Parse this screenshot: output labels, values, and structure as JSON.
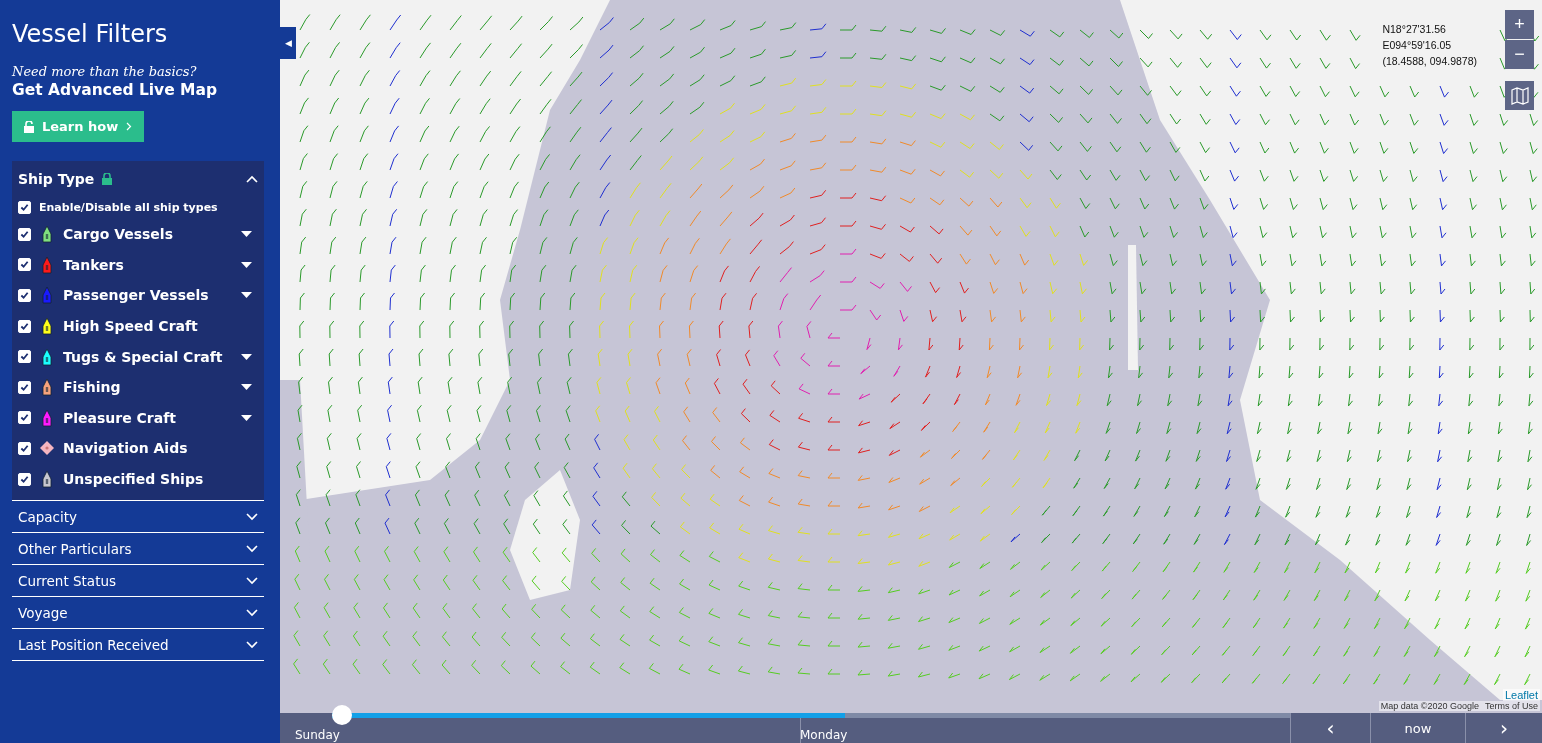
{
  "sidebar": {
    "title": "Vessel Filters",
    "promo_question": "Need more than the basics?",
    "promo_heading": "Get Advanced Live Map",
    "promo_button": "Learn how",
    "collapse_button": "◀"
  },
  "ship_type": {
    "title": "Ship Type",
    "expanded": true,
    "locked": true,
    "all_toggle": {
      "label": "Enable/Disable all ship types",
      "checked": true
    },
    "items": [
      {
        "label": "Cargo Vessels",
        "checked": true,
        "kind": "ship",
        "color": "#7fe07f",
        "expandable": true
      },
      {
        "label": "Tankers",
        "checked": true,
        "kind": "ship",
        "color": "#ff1a1a",
        "expandable": true
      },
      {
        "label": "Passenger Vessels",
        "checked": true,
        "kind": "ship",
        "color": "#1a1aff",
        "expandable": true
      },
      {
        "label": "High Speed Craft",
        "checked": true,
        "kind": "ship",
        "color": "#ffff1a",
        "expandable": false
      },
      {
        "label": "Tugs & Special Craft",
        "checked": true,
        "kind": "ship",
        "color": "#1affff",
        "expandable": true
      },
      {
        "label": "Fishing",
        "checked": true,
        "kind": "ship",
        "color": "#f7a27c",
        "expandable": true
      },
      {
        "label": "Pleasure Craft",
        "checked": true,
        "kind": "ship",
        "color": "#ff1aff",
        "expandable": true
      },
      {
        "label": "Navigation Aids",
        "checked": true,
        "kind": "diamond",
        "color": "#f5b5c0",
        "expandable": false
      },
      {
        "label": "Unspecified Ships",
        "checked": true,
        "kind": "ship",
        "color": "#c8c8d0",
        "expandable": false
      }
    ]
  },
  "sections": [
    {
      "label": "Capacity",
      "expanded": false
    },
    {
      "label": "Other Particulars",
      "expanded": false
    },
    {
      "label": "Current Status",
      "expanded": false
    },
    {
      "label": "Voyage",
      "expanded": false
    },
    {
      "label": "Last Position Received",
      "expanded": false
    }
  ],
  "coordinates": [
    "N18°27'31.56",
    "E094°59'16.05",
    "(18.4588, 094.9878)"
  ],
  "zoom_controls": [
    "+",
    "−"
  ],
  "timeline": {
    "level": 0.535,
    "days": [
      "Sunday",
      "Monday"
    ],
    "now_label": "now",
    "prev": "‹",
    "next": "›"
  },
  "attribution": {
    "leaflet": "Leaflet",
    "map_data": "Map data ©2020 Google",
    "terms": "Terms of Use"
  }
}
